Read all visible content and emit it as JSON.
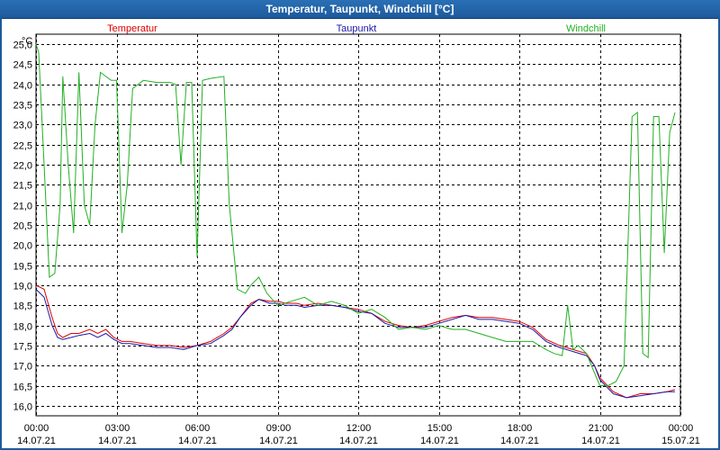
{
  "window": {
    "title": "Temperatur, Taupunkt, Windchill [°C]"
  },
  "chart_data": {
    "type": "line",
    "title": "Temperatur, Taupunkt, Windchill [°C]",
    "ylabel": "°C",
    "ylim": [
      15.75,
      25.25
    ],
    "y_ticks": [
      "25,0",
      "24,5",
      "24,0",
      "23,5",
      "23,0",
      "22,5",
      "22,0",
      "21,5",
      "21,0",
      "20,5",
      "20,0",
      "19,5",
      "19,0",
      "18,5",
      "18,0",
      "17,5",
      "17,0",
      "16,5",
      "16,0"
    ],
    "xlim": [
      0,
      24
    ],
    "x_ticks": [
      {
        "time": "00:00",
        "date": "14.07.21",
        "h": 0
      },
      {
        "time": "03:00",
        "date": "14.07.21",
        "h": 3
      },
      {
        "time": "06:00",
        "date": "14.07.21",
        "h": 6
      },
      {
        "time": "09:00",
        "date": "14.07.21",
        "h": 9
      },
      {
        "time": "12:00",
        "date": "14.07.21",
        "h": 12
      },
      {
        "time": "15:00",
        "date": "14.07.21",
        "h": 15
      },
      {
        "time": "18:00",
        "date": "14.07.21",
        "h": 18
      },
      {
        "time": "21:00",
        "date": "14.07.21",
        "h": 21
      },
      {
        "time": "00:00",
        "date": "15.07.21",
        "h": 24
      }
    ],
    "grid": true,
    "legend_placement": "top",
    "series": [
      {
        "name": "Temperatur",
        "color": "#e00000",
        "x": [
          0,
          0.3,
          0.6,
          0.8,
          1.0,
          1.3,
          1.6,
          2.0,
          2.3,
          2.6,
          2.9,
          3.2,
          3.5,
          4.0,
          4.5,
          5.0,
          5.5,
          6.0,
          6.5,
          7.0,
          7.3,
          7.6,
          8.0,
          8.3,
          8.7,
          9.0,
          9.3,
          9.7,
          10.0,
          10.5,
          11.0,
          11.5,
          12.0,
          12.5,
          13.0,
          13.5,
          14.0,
          14.5,
          15.0,
          15.5,
          16.0,
          16.5,
          17.0,
          17.5,
          18.0,
          18.5,
          19.0,
          19.5,
          20.0,
          20.5,
          20.8,
          21.0,
          21.5,
          22.0,
          22.5,
          23.0,
          23.5,
          23.8
        ],
        "values": [
          19.0,
          18.9,
          18.2,
          17.8,
          17.7,
          17.8,
          17.8,
          17.9,
          17.8,
          17.9,
          17.7,
          17.6,
          17.6,
          17.55,
          17.5,
          17.5,
          17.45,
          17.5,
          17.6,
          17.8,
          17.95,
          18.2,
          18.55,
          18.65,
          18.6,
          18.6,
          18.55,
          18.55,
          18.5,
          18.55,
          18.5,
          18.45,
          18.4,
          18.3,
          18.1,
          18.0,
          17.95,
          18.0,
          18.1,
          18.2,
          18.25,
          18.2,
          18.2,
          18.15,
          18.1,
          17.95,
          17.65,
          17.5,
          17.4,
          17.3,
          17.0,
          16.7,
          16.35,
          16.2,
          16.3,
          16.3,
          16.35,
          16.4
        ]
      },
      {
        "name": "Taupunkt",
        "color": "#1a1aa8",
        "x": [
          0,
          0.3,
          0.6,
          0.8,
          1.0,
          1.3,
          1.6,
          2.0,
          2.3,
          2.6,
          2.9,
          3.2,
          3.5,
          4.0,
          4.5,
          5.0,
          5.5,
          6.0,
          6.5,
          7.0,
          7.3,
          7.6,
          8.0,
          8.3,
          8.7,
          9.0,
          9.3,
          9.7,
          10.0,
          10.5,
          11.0,
          11.5,
          12.0,
          12.5,
          13.0,
          13.5,
          14.0,
          14.5,
          15.0,
          15.5,
          16.0,
          16.5,
          17.0,
          17.5,
          18.0,
          18.5,
          19.0,
          19.5,
          20.0,
          20.5,
          20.8,
          21.0,
          21.5,
          22.0,
          22.5,
          23.0,
          23.5,
          23.8
        ],
        "values": [
          18.9,
          18.7,
          18.0,
          17.7,
          17.65,
          17.7,
          17.75,
          17.8,
          17.7,
          17.8,
          17.65,
          17.55,
          17.55,
          17.5,
          17.45,
          17.45,
          17.4,
          17.5,
          17.55,
          17.75,
          17.9,
          18.2,
          18.5,
          18.65,
          18.55,
          18.55,
          18.5,
          18.5,
          18.45,
          18.5,
          18.5,
          18.45,
          18.35,
          18.3,
          18.05,
          17.95,
          17.95,
          17.95,
          18.05,
          18.15,
          18.25,
          18.15,
          18.15,
          18.1,
          18.05,
          17.9,
          17.6,
          17.45,
          17.35,
          17.25,
          17.0,
          16.65,
          16.3,
          16.2,
          16.25,
          16.3,
          16.35,
          16.35
        ]
      },
      {
        "name": "Windchill",
        "color": "#22b022",
        "x": [
          0,
          0.1,
          0.3,
          0.5,
          0.7,
          0.9,
          1.0,
          1.2,
          1.4,
          1.6,
          1.8,
          2.0,
          2.2,
          2.4,
          2.6,
          2.8,
          3.0,
          3.2,
          3.4,
          3.6,
          3.8,
          4.0,
          4.5,
          5.0,
          5.2,
          5.4,
          5.6,
          5.8,
          6.0,
          6.2,
          6.5,
          7.0,
          7.2,
          7.5,
          7.8,
          8.0,
          8.3,
          8.6,
          9.0,
          9.5,
          10.0,
          10.5,
          11.0,
          11.5,
          12.0,
          12.5,
          13.0,
          13.5,
          14.0,
          14.5,
          15.0,
          15.5,
          16.0,
          16.5,
          17.0,
          17.5,
          18.0,
          18.5,
          19.0,
          19.3,
          19.6,
          19.8,
          20.0,
          20.2,
          20.5,
          21.0,
          21.3,
          21.6,
          21.9,
          22.2,
          22.4,
          22.6,
          22.8,
          23.0,
          23.2,
          23.4,
          23.6,
          23.8
        ],
        "values": [
          25.0,
          24.8,
          22.0,
          19.2,
          19.3,
          21.0,
          24.2,
          22.0,
          20.3,
          24.3,
          21.0,
          20.5,
          23.0,
          24.3,
          24.2,
          24.1,
          24.1,
          20.3,
          21.5,
          23.9,
          24.0,
          24.1,
          24.05,
          24.05,
          24.0,
          22.0,
          24.05,
          24.05,
          19.7,
          24.1,
          24.15,
          24.2,
          21.0,
          18.9,
          18.8,
          19.0,
          19.2,
          18.8,
          18.5,
          18.6,
          18.7,
          18.5,
          18.6,
          18.5,
          18.3,
          18.4,
          18.2,
          17.9,
          17.95,
          17.9,
          18.0,
          17.9,
          17.9,
          17.8,
          17.7,
          17.6,
          17.6,
          17.6,
          17.4,
          17.3,
          17.25,
          18.5,
          17.4,
          17.5,
          17.3,
          16.5,
          16.5,
          16.6,
          17.0,
          23.2,
          23.3,
          17.3,
          17.2,
          23.2,
          23.2,
          19.8,
          22.8,
          23.3
        ]
      }
    ]
  }
}
